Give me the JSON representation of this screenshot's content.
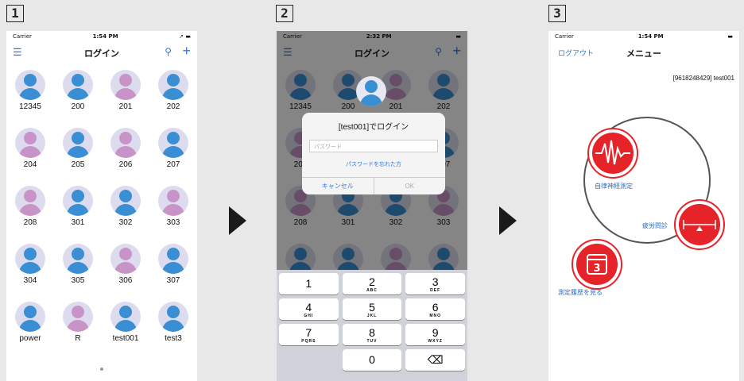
{
  "steps": [
    "1",
    "2",
    "3"
  ],
  "phone1": {
    "carrier": "Carrier",
    "time": "1:54 PM",
    "title": "ログイン",
    "users": [
      {
        "name": "12345",
        "c": "b"
      },
      {
        "name": "200",
        "c": "b"
      },
      {
        "name": "201",
        "c": "p"
      },
      {
        "name": "202",
        "c": "b"
      },
      {
        "name": "204",
        "c": "p"
      },
      {
        "name": "205",
        "c": "b"
      },
      {
        "name": "206",
        "c": "p"
      },
      {
        "name": "207",
        "c": "b"
      },
      {
        "name": "208",
        "c": "p"
      },
      {
        "name": "301",
        "c": "b"
      },
      {
        "name": "302",
        "c": "b"
      },
      {
        "name": "303",
        "c": "p"
      },
      {
        "name": "304",
        "c": "b"
      },
      {
        "name": "305",
        "c": "b"
      },
      {
        "name": "306",
        "c": "p"
      },
      {
        "name": "307",
        "c": "b"
      },
      {
        "name": "power",
        "c": "b"
      },
      {
        "name": "R",
        "c": "p"
      },
      {
        "name": "test001",
        "c": "b"
      },
      {
        "name": "test3",
        "c": "b"
      }
    ]
  },
  "phone2": {
    "carrier": "Carrier",
    "time": "2:32 PM",
    "title": "ログイン",
    "dialog": {
      "title": "[test001]でログイン",
      "placeholder": "パスワード",
      "forgot": "パスワードを忘れた方",
      "cancel": "キャンセル",
      "ok": "OK"
    },
    "keys": [
      {
        "n": "1",
        "s": ""
      },
      {
        "n": "2",
        "s": "ABC"
      },
      {
        "n": "3",
        "s": "DEF"
      },
      {
        "n": "4",
        "s": "GHI"
      },
      {
        "n": "5",
        "s": "JKL"
      },
      {
        "n": "6",
        "s": "MNO"
      },
      {
        "n": "7",
        "s": "PQRS"
      },
      {
        "n": "8",
        "s": "TUV"
      },
      {
        "n": "9",
        "s": "WXYZ"
      },
      {
        "n": "",
        "s": ""
      },
      {
        "n": "0",
        "s": ""
      },
      {
        "n": "⌫",
        "s": ""
      }
    ]
  },
  "phone3": {
    "carrier": "Carrier",
    "time": "1:54 PM",
    "logout": "ログアウト",
    "title": "メニュー",
    "user": "[9618248429] test001",
    "menu": {
      "autonomic": "自律神経測定",
      "fatigue": "疲労問診",
      "history": "測定履歴を見る"
    }
  },
  "colors": {
    "accent": "#e62329",
    "link": "#2a6fc2",
    "blue": "#3a8ed4",
    "pink": "#c894c8"
  }
}
